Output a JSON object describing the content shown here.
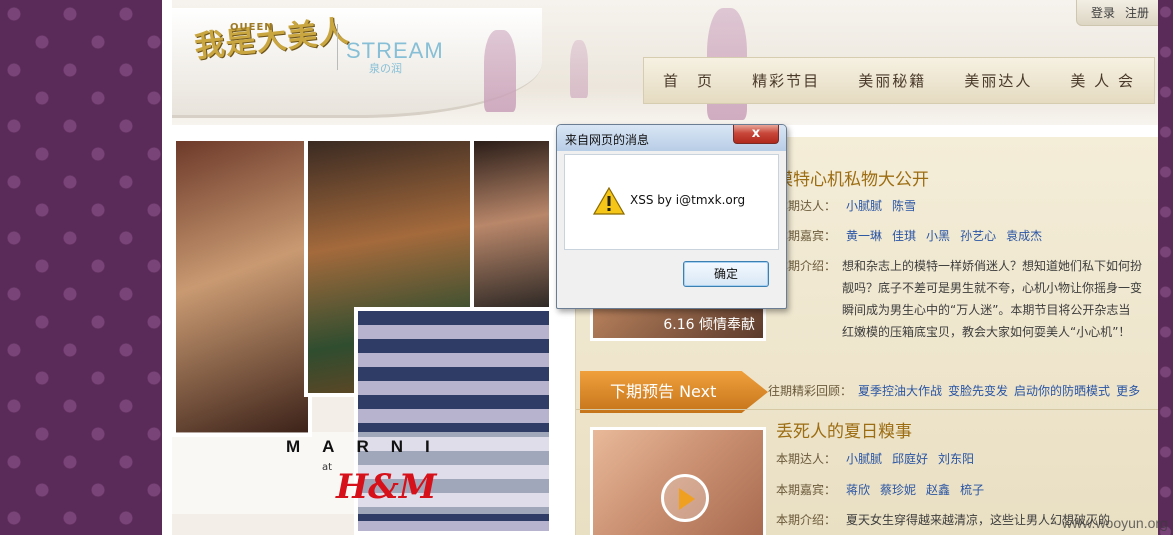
{
  "header": {
    "logo_text": "我是大美人",
    "logo_queen": "QUEEN",
    "brand": "STREAM",
    "brand_sub": "泉の润",
    "login_label": "登录",
    "register_label": "注册"
  },
  "nav": [
    "首　页",
    "精彩节目",
    "美丽秘籍",
    "美丽达人",
    "美 人 会"
  ],
  "hero": {
    "marni": "MARNI",
    "at": "at",
    "hm": "H&M"
  },
  "current": {
    "title": "模特心机私物大公开",
    "thumb_caption": "6.16 倾情奉献",
    "host_label": "本期达人：",
    "hosts": [
      "小腻腻",
      "陈雪"
    ],
    "guest_label": "本期嘉宾：",
    "guests": [
      "黄一琳",
      "佳琪",
      "小黑",
      "孙艺心",
      "袁成杰"
    ],
    "intro_label": "本期介绍：",
    "intro_text": "想和杂志上的模特一样娇俏迷人？想知道她们私下如何扮靓吗？底子不差可是男生就不夸，心机小物让你摇身一变瞬间成为男生心中的“万人迷”。本期节目将公开杂志当红嫩模的压箱底宝贝，教会大家如何耍美人“小心机”！"
  },
  "next": {
    "banner": "下期预告 Next",
    "past_label": "往期精彩回顾：",
    "past_links": [
      "夏季控油大作战",
      "变脸先变发",
      "启动你的防晒模式",
      "更多"
    ]
  },
  "upcoming": {
    "title": "丢死人的夏日糗事",
    "host_label": "本期达人：",
    "hosts": [
      "小腻腻",
      "邱庭好",
      "刘东阳"
    ],
    "guest_label": "本期嘉宾：",
    "guests": [
      "蒋欣",
      "蔡珍妮",
      "赵鑫",
      "梳子"
    ],
    "intro_label": "本期介绍：",
    "intro_text": "夏天女生穿得越来越清凉，这些让男人幻想破灭的"
  },
  "dialog": {
    "title": "来自网页的消息",
    "close_label": "x",
    "message": "XSS by i@tmxk.org",
    "ok_label": "确定"
  },
  "watermark": "www.wooyun.org"
}
